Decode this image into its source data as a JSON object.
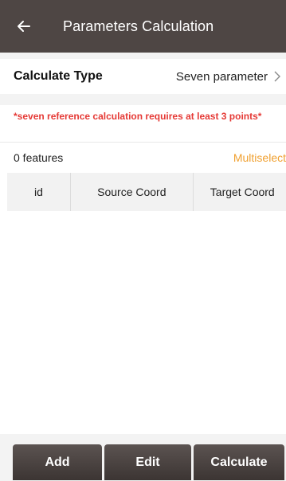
{
  "header": {
    "title": "Parameters Calculation",
    "back_icon": "arrow-left-icon"
  },
  "calculate_type": {
    "label": "Calculate Type",
    "value": "Seven parameter",
    "chevron_icon": "chevron-right-icon"
  },
  "warning": "*seven reference calculation requires at least 3 points*",
  "features": {
    "count_text": "0 features",
    "multiselect_label": "Multiselect"
  },
  "table": {
    "columns": [
      "id",
      "Source Coord",
      "Target Coord"
    ],
    "rows": []
  },
  "actions": {
    "add": "Add",
    "edit": "Edit",
    "calculate": "Calculate"
  },
  "colors": {
    "header_bg": "#4e4644",
    "warning": "#e53935",
    "accent": "#f0a030",
    "button_bg": "#4a4240"
  }
}
